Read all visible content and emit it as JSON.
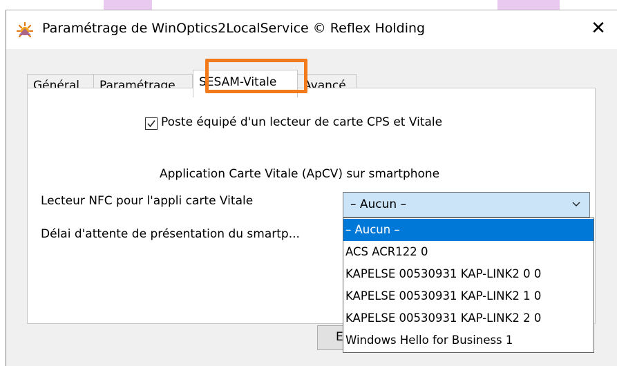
{
  "window": {
    "title": "Paramétrage de WinOptics2LocalService © Reflex Holding",
    "close_glyph": "✕"
  },
  "tabs": [
    {
      "label": "Général",
      "active": false
    },
    {
      "label": "Paramétrage",
      "active": false
    },
    {
      "label": "SESAM-Vitale",
      "active": true
    },
    {
      "label": "Avancé",
      "active": false
    }
  ],
  "panel": {
    "checkbox_label": "Poste équipé d'un lecteur de carte CPS et Vitale",
    "checkbox_checked": true,
    "apcv_heading": "Application Carte Vitale (ApCV) sur smartphone",
    "nfc_label": "Lecteur NFC pour l'appli carte Vitale",
    "nfc_selected": "– Aucun –",
    "delay_label": "Délai d'attente de présentation du smartp...",
    "dropdown_options": [
      "– Aucun –",
      "ACS ACR122 0",
      "KAPELSE 00530931 KAP-LINK2 0 0",
      "KAPELSE 00530931 KAP-LINK2 1 0",
      "KAPELSE 00530931 KAP-LINK2 2 0",
      "Windows Hello for Business 1"
    ],
    "hidden_button_text": "E"
  },
  "colors": {
    "highlight": "#f27a1a",
    "selection": "#0078d7",
    "combo_bg": "#cce4f7"
  },
  "icons": [
    "app-sun-icon",
    "close-icon",
    "checkmark-icon",
    "chevron-down-icon"
  ]
}
